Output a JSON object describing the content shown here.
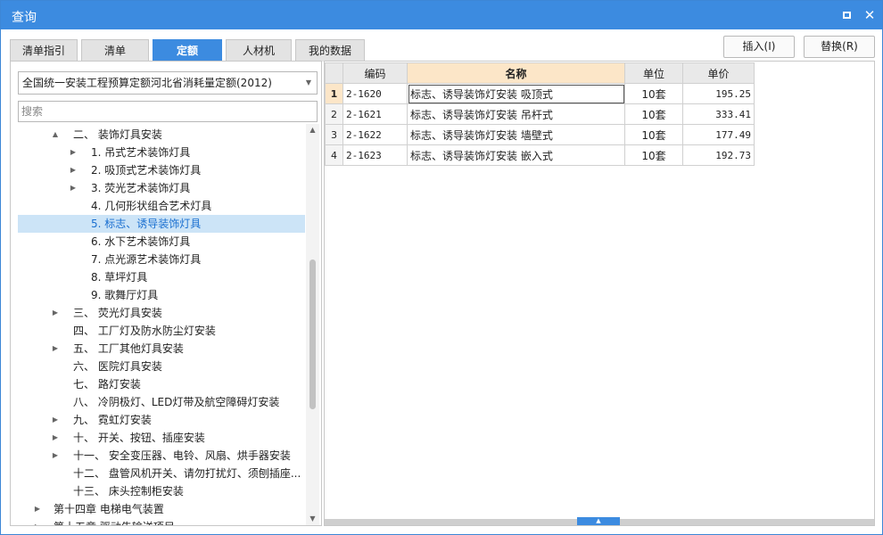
{
  "window": {
    "title": "查询"
  },
  "tabs": [
    {
      "label": "清单指引",
      "active": false
    },
    {
      "label": "清单",
      "active": false
    },
    {
      "label": "定额",
      "active": true
    },
    {
      "label": "人材机",
      "active": false
    },
    {
      "label": "我的数据",
      "active": false
    }
  ],
  "actions": {
    "insert_label": "插入(I)",
    "replace_label": "替换(R)"
  },
  "library": {
    "selected": "全国统一安装工程预算定额河北省消耗量定额(2012)"
  },
  "search": {
    "placeholder": "搜索"
  },
  "tree": [
    {
      "label": "二、 装饰灯具安装",
      "toggle": "▲",
      "selected": false
    },
    {
      "label": "1. 吊式艺术装饰灯具",
      "toggle": "▶",
      "selected": false
    },
    {
      "label": "2. 吸顶式艺术装饰灯具",
      "toggle": "▶",
      "selected": false
    },
    {
      "label": "3. 荧光艺术装饰灯具",
      "toggle": "▶",
      "selected": false
    },
    {
      "label": "4. 几何形状组合艺术灯具",
      "toggle": "",
      "selected": false
    },
    {
      "label": "5. 标志、诱导装饰灯具",
      "toggle": "",
      "selected": true
    },
    {
      "label": "6. 水下艺术装饰灯具",
      "toggle": "",
      "selected": false
    },
    {
      "label": "7. 点光源艺术装饰灯具",
      "toggle": "",
      "selected": false
    },
    {
      "label": "8. 草坪灯具",
      "toggle": "",
      "selected": false
    },
    {
      "label": "9. 歌舞厅灯具",
      "toggle": "",
      "selected": false
    },
    {
      "label": "三、 荧光灯具安装",
      "toggle": "▶",
      "selected": false
    },
    {
      "label": "四、 工厂灯及防水防尘灯安装",
      "toggle": "",
      "selected": false
    },
    {
      "label": "五、 工厂其他灯具安装",
      "toggle": "▶",
      "selected": false
    },
    {
      "label": "六、 医院灯具安装",
      "toggle": "",
      "selected": false
    },
    {
      "label": "七、 路灯安装",
      "toggle": "",
      "selected": false
    },
    {
      "label": "八、 冷阴极灯、LED灯带及航空障碍灯安装",
      "toggle": "",
      "selected": false
    },
    {
      "label": "九、 霓虹灯安装",
      "toggle": "▶",
      "selected": false
    },
    {
      "label": "十、 开关、按钮、插座安装",
      "toggle": "▶",
      "selected": false
    },
    {
      "label": "十一、 安全变压器、电铃、风扇、烘手器安装",
      "toggle": "▶",
      "selected": false
    },
    {
      "label": "十二、 盘管风机开关、请勿打扰灯、须刨插座...",
      "toggle": "",
      "selected": false
    },
    {
      "label": "十三、 床头控制柜安装",
      "toggle": "",
      "selected": false
    },
    {
      "label": "第十四章 电梯电气装置",
      "toggle": "▶",
      "selected": false
    },
    {
      "label": "第十五章 驱动告输送项目",
      "toggle": "▶",
      "selected": false
    }
  ],
  "grid": {
    "headers": {
      "code": "编码",
      "name": "名称",
      "unit": "单位",
      "price": "单价"
    },
    "rows": [
      {
        "num": "1",
        "code": "2-1620",
        "name": "标志、诱导装饰灯安装 吸顶式",
        "unit": "10套",
        "price": "195.25"
      },
      {
        "num": "2",
        "code": "2-1621",
        "name": "标志、诱导装饰灯安装 吊杆式",
        "unit": "10套",
        "price": "333.41"
      },
      {
        "num": "3",
        "code": "2-1622",
        "name": "标志、诱导装饰灯安装 墙壁式",
        "unit": "10套",
        "price": "177.49"
      },
      {
        "num": "4",
        "code": "2-1623",
        "name": "标志、诱导装饰灯安装 嵌入式",
        "unit": "10套",
        "price": "192.73"
      }
    ]
  },
  "colors": {
    "accent": "#3c8be0",
    "selected_row": "#cce4f7",
    "header_active": "#fce6c8"
  },
  "icons": {
    "restore": "restore-icon",
    "close": "close-icon",
    "dropdown": "chevron-down-icon"
  }
}
